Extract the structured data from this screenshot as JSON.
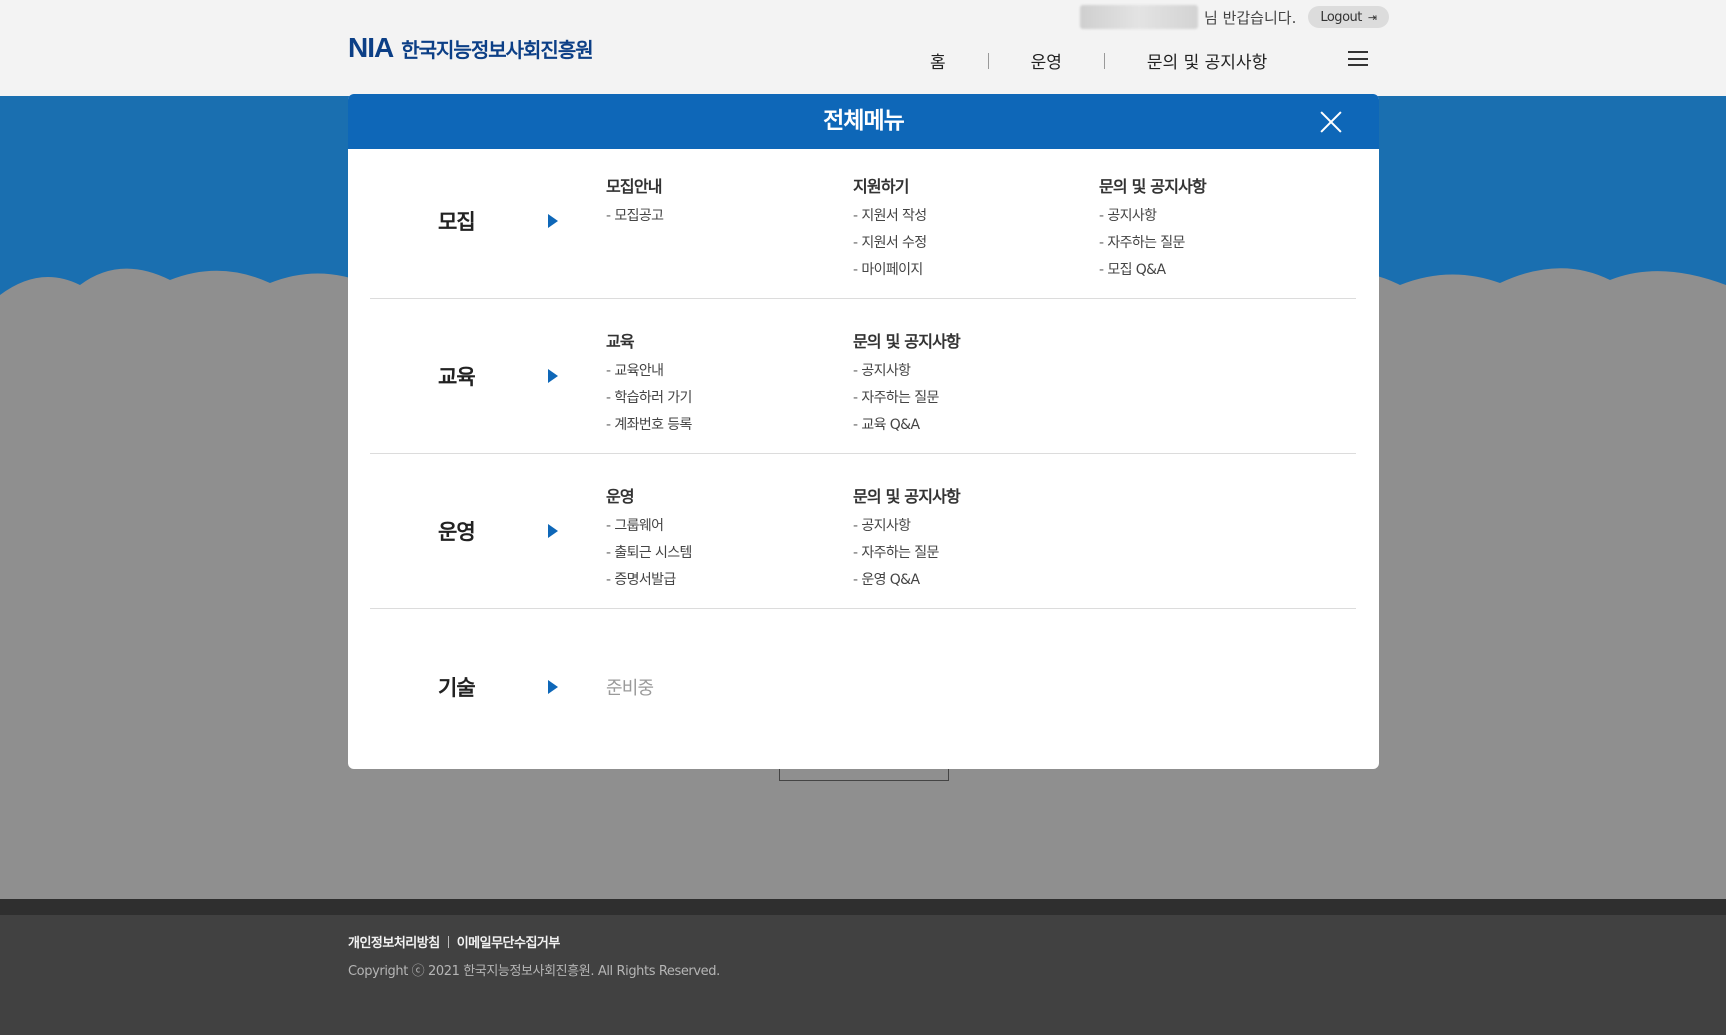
{
  "header": {
    "logo_mark": "NIA",
    "logo_text": "한국지능정보사회진흥원",
    "greeting": "님 반갑습니다.",
    "logout_label": "Logout",
    "nav": [
      "홈",
      "운영",
      "문의 및 공지사항"
    ]
  },
  "modal": {
    "title": "전체메뉴",
    "sections": [
      {
        "category": "모집",
        "groups": [
          {
            "title": "모집안내",
            "items": [
              "모집공고"
            ]
          },
          {
            "title": "지원하기",
            "items": [
              "지원서 작성",
              "지원서 수정",
              "마이페이지"
            ]
          },
          {
            "title": "문의 및 공지사항",
            "items": [
              "공지사항",
              "자주하는 질문",
              "모집 Q&A"
            ]
          }
        ]
      },
      {
        "category": "교육",
        "groups": [
          {
            "title": "교육",
            "items": [
              "교육안내",
              "학습하러 가기",
              "계좌번호 등록"
            ]
          },
          {
            "title": "문의 및 공지사항",
            "items": [
              "공지사항",
              "자주하는 질문",
              "교육 Q&A"
            ]
          }
        ]
      },
      {
        "category": "운영",
        "groups": [
          {
            "title": "운영",
            "items": [
              "그룹웨어",
              "출퇴근 시스템",
              "증명서발급"
            ]
          },
          {
            "title": "문의 및 공지사항",
            "items": [
              "공지사항",
              "자주하는 질문",
              "운영 Q&A"
            ]
          }
        ]
      },
      {
        "category": "기술",
        "status": "준비중"
      }
    ]
  },
  "footer": {
    "links": [
      "개인정보처리방침",
      "이메일무단수집거부"
    ],
    "copyright": "Copyright ⓒ 2021 한국지능정보사회진흥원. All Rights Reserved."
  },
  "colors": {
    "brand_blue": "#0e67b8",
    "logo_navy": "#0c3f86",
    "overlay_gray": "#8f8f8f",
    "footer_dark": "#414141"
  },
  "icons": {
    "close": "close-icon",
    "menu": "hamburger-icon",
    "arrow": "triangle-right-icon",
    "logout": "logout-icon"
  }
}
